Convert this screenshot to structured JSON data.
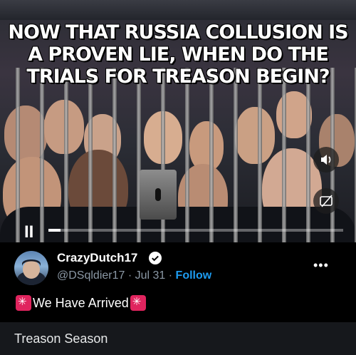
{
  "video": {
    "headline": "NOW THAT RUSSIA COLLUSION IS A PROVEN LIE, WHEN DO THE TRIALS FOR TREASON BEGIN?",
    "pause_icon": "II",
    "progress_fraction": 0.04,
    "volume_icon": "speaker-icon",
    "captions_icon": "captions-icon"
  },
  "tweet": {
    "author_name": "CrazyDutch17",
    "handle": "@DSqldier17",
    "separator": " · ",
    "date": "Jul 31",
    "follow_label": "Follow",
    "more_icon": "•••",
    "text": "We Have Arrived"
  },
  "bottom": {
    "text": "Treason Season"
  },
  "colors": {
    "accent": "#1d9bf0",
    "siren": "#e0245e",
    "background": "#000000"
  }
}
